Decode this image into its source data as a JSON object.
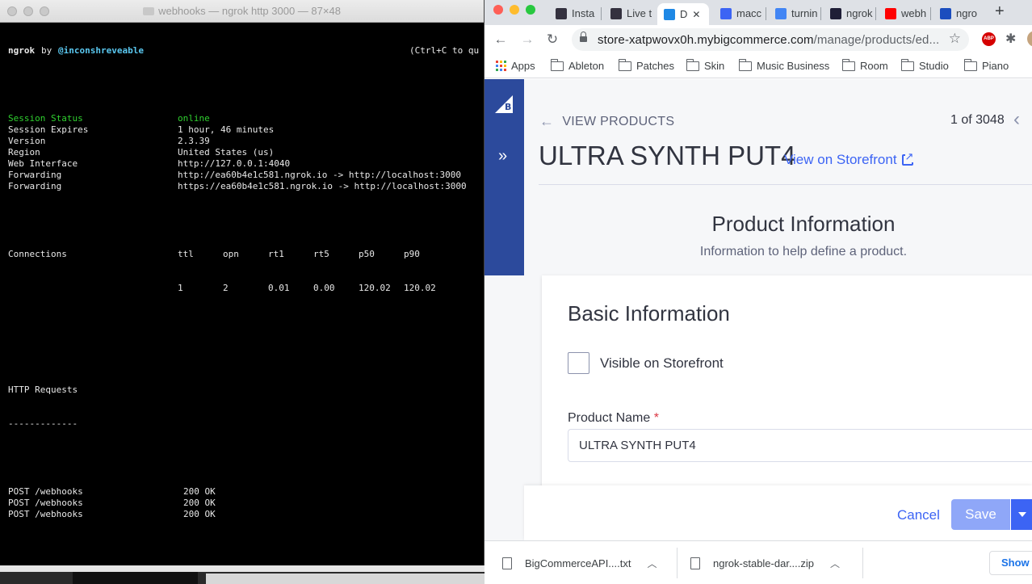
{
  "terminal": {
    "title": "webhooks — ngrok http 3000 — 87×48",
    "brand": "ngrok",
    "by": "by",
    "author": "@inconshreveable",
    "quit_hint": "(Ctrl+C to qu",
    "status": [
      {
        "label": "Session Status",
        "value": "online"
      },
      {
        "label": "Session Expires",
        "value": "1 hour, 46 minutes"
      },
      {
        "label": "Version",
        "value": "2.3.39"
      },
      {
        "label": "Region",
        "value": "United States (us)"
      },
      {
        "label": "Web Interface",
        "value": "http://127.0.0.1:4040"
      },
      {
        "label": "Forwarding",
        "value": "http://ea60b4e1c581.ngrok.io -> http://localhost:3000"
      },
      {
        "label": "Forwarding",
        "value": "https://ea60b4e1c581.ngrok.io -> http://localhost:3000"
      }
    ],
    "connections": {
      "label": "Connections",
      "headers": [
        "ttl",
        "opn",
        "rt1",
        "rt5",
        "p50",
        "p90"
      ],
      "values": [
        "1",
        "2",
        "0.01",
        "0.00",
        "120.02",
        "120.02"
      ]
    },
    "http_requests": {
      "heading": "HTTP Requests",
      "underline": "-------------",
      "rows": [
        {
          "request": "POST /webhooks",
          "status": "200 OK"
        },
        {
          "request": "POST /webhooks",
          "status": "200 OK"
        },
        {
          "request": "POST /webhooks",
          "status": "200 OK"
        }
      ]
    }
  },
  "browser": {
    "tabs": [
      {
        "label": "Insta",
        "favicon": "bigcommerce-icon",
        "color": "#34313f"
      },
      {
        "label": "Live t",
        "favicon": "bigcommerce-icon",
        "color": "#34313f"
      },
      {
        "label": "D",
        "favicon": "app-icon",
        "color": "#1e88e5",
        "active": true,
        "close": "✕"
      },
      {
        "label": "macc",
        "favicon": "bracket-icon",
        "color": "#3c64f4"
      },
      {
        "label": "turnin",
        "favicon": "google-icon",
        "color": "#4285f4"
      },
      {
        "label": "ngrok",
        "favicon": "ngrok-icon",
        "color": "#1f1e37"
      },
      {
        "label": "webh",
        "favicon": "youtube-icon",
        "color": "#ff0000"
      },
      {
        "label": "ngro",
        "favicon": "ngrok-icon",
        "color": "#1b4dbe"
      }
    ],
    "new_tab": "+",
    "url_host": "store-xatpwovx0h.mybigcommerce.com",
    "url_path": "/manage/products/ed...",
    "abp_label": "ABP",
    "bookmarks": [
      {
        "label": "Apps",
        "icon": "apps-icon"
      },
      {
        "label": "Ableton",
        "icon": "folder-icon"
      },
      {
        "label": "Patches",
        "icon": "folder-icon"
      },
      {
        "label": "Skin",
        "icon": "folder-icon"
      },
      {
        "label": "Music Business",
        "icon": "folder-icon"
      },
      {
        "label": "Room",
        "icon": "folder-icon"
      },
      {
        "label": "Studio",
        "icon": "folder-icon"
      },
      {
        "label": "Piano",
        "icon": "folder-icon"
      }
    ],
    "downloads": [
      {
        "name": "BigCommerceAPI....txt",
        "icon": "file-icon"
      },
      {
        "name": "ngrok-stable-dar....zip",
        "icon": "file-icon"
      }
    ],
    "show_all": "Show all"
  },
  "page": {
    "back_label": "VIEW PRODUCTS",
    "pager": "1 of 3048",
    "product_title": "ULTRA SYNTH PUT4",
    "storefront_link": "View on Storefront",
    "section_title": "Product Information",
    "section_subtitle": "Information to help define a product.",
    "card_title": "Basic Information",
    "visible_label": "Visible on Storefront",
    "visible_checked": false,
    "name_label": "Product Name",
    "name_required": "*",
    "name_value": "ULTRA SYNTH PUT4",
    "cancel_label": "Cancel",
    "save_label": "Save"
  },
  "colors": {
    "accent": "#3c64f4",
    "sidebar": "#2c4a9c",
    "terminal_green": "#2fd02f",
    "terminal_cyan": "#5ac8f0"
  }
}
